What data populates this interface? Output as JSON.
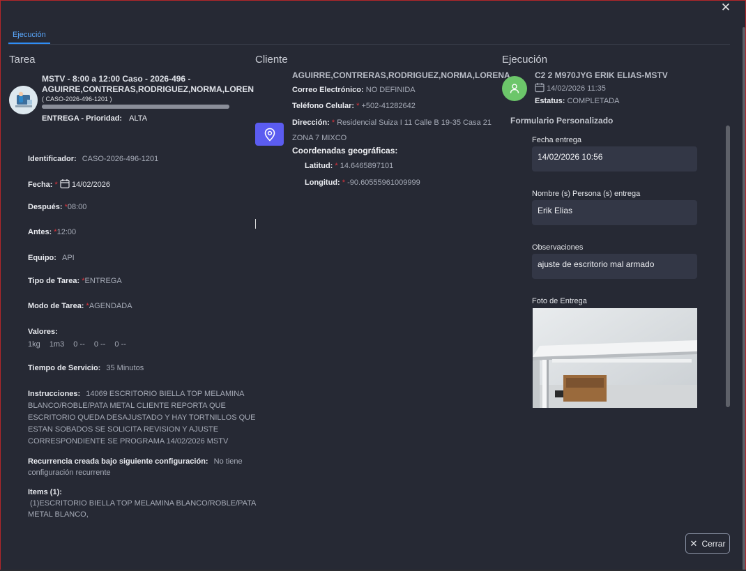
{
  "tab": {
    "label": "Ejecución"
  },
  "sections": {
    "tarea": "Tarea",
    "cliente": "Cliente",
    "ejecucion": "Ejecución"
  },
  "tarea": {
    "title_line1": "MSTV - 8:00 a 12:00 Caso - 2026-496 -",
    "title_line2": "AGUIRRE,CONTRERAS,RODRIGUEZ,NORMA,LOREN",
    "case_id": "( CASO-2026-496-1201 )",
    "progress": 1.0,
    "type_priority_label": "ENTREGA - Prioridad:",
    "priority": "ALTA",
    "identificador_label": "Identificador:",
    "identificador": "CASO-2026-496-1201",
    "fecha_label": "Fecha:",
    "fecha": "14/02/2026",
    "despues_label": "Después:",
    "despues": "08:00",
    "antes_label": "Antes:",
    "antes": "12:00",
    "equipo_label": "Equipo:",
    "equipo": "API",
    "tipo_label": "Tipo de Tarea:",
    "tipo": "ENTREGA",
    "modo_label": "Modo de Tarea:",
    "modo": "AGENDADA",
    "valores_label": "Valores:",
    "valores": [
      "1kg",
      "1m3",
      "0 --",
      "0 --",
      "0 --"
    ],
    "tiempo_label": "Tiempo de Servicio:",
    "tiempo": "35 Minutos",
    "instrucciones_label": "Instrucciones:",
    "instrucciones_l1": "14069 ESCRITORIO BIELLA TOP MELAMINA",
    "instrucciones_l2": "BLANCO/ROBLE/PATA METAL CLIENTE REPORTA QUE",
    "instrucciones_l3": "ESCRITORIO QUEDA DESAJUSTADO Y HAY TORTNILLOS QUE",
    "instrucciones_l4": "ESTAN SOBADOS SE SOLICITA REVISION Y AJUSTE",
    "instrucciones_l5": "CORRESPONDIENTE SE PROGRAMA 14/02/2026 MSTV",
    "recurrencia_label": "Recurrencia creada bajo siguiente configuración:",
    "recurrencia_l1": "No tiene",
    "recurrencia_l2": "configuración recurrente",
    "items_label": "Items (1):",
    "items_l1": "(1)ESCRITORIO BIELLA TOP MELAMINA BLANCO/ROBLE/PATA",
    "items_l2": "METAL BLANCO,"
  },
  "cliente": {
    "nombre": "AGUIRRE,CONTRERAS,RODRIGUEZ,NORMA,LORENA",
    "correo_label": "Correo Electrónico:",
    "correo": "NO DEFINIDA",
    "telefono_label": "Teléfono Celular:",
    "telefono": "+502-41282642",
    "direccion_label": "Dirección:",
    "direccion_l1": "Residencial Suiza I 11 Calle B 19-35 Casa 21",
    "direccion_l2": "ZONA 7 MIXCO",
    "coords_label": "Coordenadas geográficas:",
    "latitud_label": "Latitud:",
    "latitud": "14.6465897101",
    "longitud_label": "Longitud:",
    "longitud": "-90.60555961009999"
  },
  "ejecucion": {
    "recurso": "C2 2 M970JYG ERIK ELIAS-MSTV",
    "fecha": "14/02/2026 11:35",
    "estatus_label": "Estatus:",
    "estatus": "COMPLETADA",
    "form_title": "Formulario Personalizado",
    "fecha_entrega_label": "Fecha entrega",
    "fecha_entrega": "14/02/2026 10:56",
    "nombre_label": "Nombre (s) Persona (s) entrega",
    "nombre": "Erik Elias",
    "observaciones_label": "Observaciones",
    "observaciones": "ajuste de escritorio mal armado",
    "foto_label": "Foto de Entrega"
  },
  "footer": {
    "cerrar": "Cerrar"
  },
  "colors": {
    "accent": "#2f8df5",
    "location_button": "#5b5cf0",
    "avatar_green": "#6cc66a",
    "required": "#e0323b"
  }
}
